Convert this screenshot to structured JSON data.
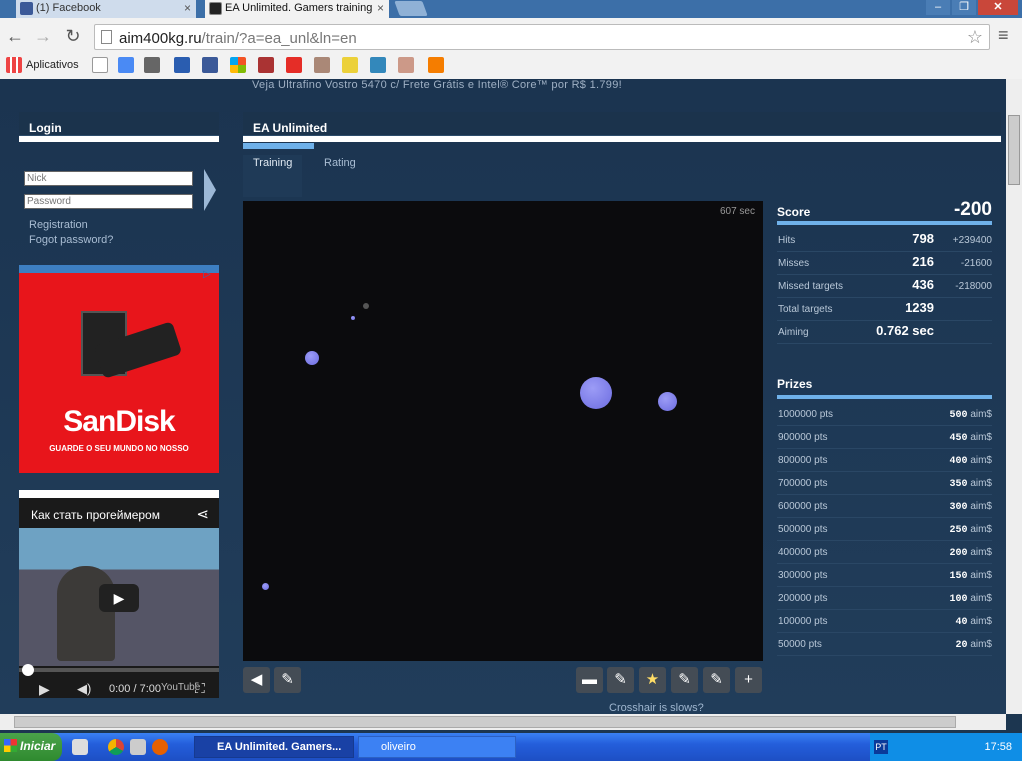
{
  "browser": {
    "tabs": [
      {
        "label": "(1) Facebook"
      },
      {
        "label": "EA Unlimited. Gamers training"
      }
    ],
    "url_host": "aim400kg.ru",
    "url_path": "/train/?a=ea_unl&ln=en",
    "bookmarks_label": "Aplicativos"
  },
  "page": {
    "ad_text": "Veja Ultrafino Vostro 5470 c/ Frete Grátis e Intel® Core™ por R$ 1.799!",
    "login": {
      "title": "Login",
      "nick_placeholder": "Nick",
      "password_placeholder": "Password",
      "registration": "Registration",
      "forgot": "Fogot password?"
    },
    "banner": {
      "brand": "SanDisk",
      "slogan": "GUARDE O SEU MUNDO NO NOSSO"
    },
    "video": {
      "title": "Как стать прогеймером",
      "time": "0:00 / 7:00"
    },
    "game": {
      "title": "EA Unlimited",
      "tabs": [
        "Training",
        "Rating"
      ],
      "timer": "607 sec",
      "crosshair_link": "Crosshair is slows?"
    },
    "score": {
      "label": "Score",
      "value": "-200",
      "stats": [
        {
          "label": "Hits",
          "value": "798",
          "delta": "+239400"
        },
        {
          "label": "Misses",
          "value": "216",
          "delta": "-21600"
        },
        {
          "label": "Missed targets",
          "value": "436",
          "delta": "-218000"
        },
        {
          "label": "Total targets",
          "value": "1239",
          "delta": ""
        },
        {
          "label": "Aiming",
          "value": "0.762 sec",
          "delta": ""
        }
      ]
    },
    "prizes": {
      "label": "Prizes",
      "rows": [
        {
          "pts": "1000000 pts",
          "amount": "500",
          "unit": "aim$"
        },
        {
          "pts": "900000 pts",
          "amount": "450",
          "unit": "aim$"
        },
        {
          "pts": "800000 pts",
          "amount": "400",
          "unit": "aim$"
        },
        {
          "pts": "700000 pts",
          "amount": "350",
          "unit": "aim$"
        },
        {
          "pts": "600000 pts",
          "amount": "300",
          "unit": "aim$"
        },
        {
          "pts": "500000 pts",
          "amount": "250",
          "unit": "aim$"
        },
        {
          "pts": "400000 pts",
          "amount": "200",
          "unit": "aim$"
        },
        {
          "pts": "300000 pts",
          "amount": "150",
          "unit": "aim$"
        },
        {
          "pts": "200000 pts",
          "amount": "100",
          "unit": "aim$"
        },
        {
          "pts": "100000 pts",
          "amount": "40",
          "unit": "aim$"
        },
        {
          "pts": "50000 pts",
          "amount": "20",
          "unit": "aim$"
        }
      ]
    }
  },
  "taskbar": {
    "start": "Iniciar",
    "tasks": [
      {
        "label": "EA Unlimited. Gamers..."
      },
      {
        "label": "oliveiro"
      }
    ],
    "lang": "PT",
    "clock": "17:58"
  },
  "colors": {
    "accent": "#6fb1ea",
    "page_bg": "#1c3650",
    "target": "#7b7bec"
  }
}
